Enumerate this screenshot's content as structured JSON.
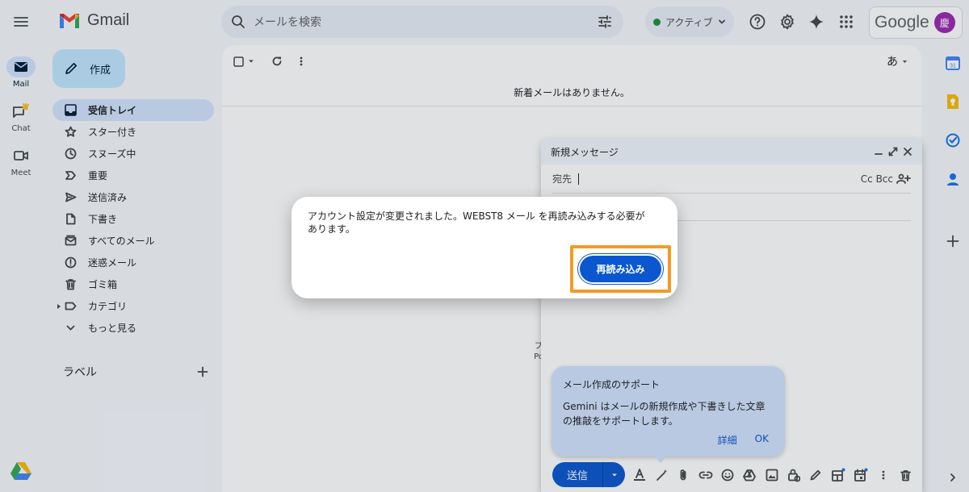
{
  "topbar": {
    "app_name": "Gmail",
    "search_placeholder": "メールを検索",
    "status_label": "アクティブ",
    "google_word": "Google",
    "avatar_initial": "慶"
  },
  "rail": {
    "items": [
      {
        "label": "Mail",
        "icon": "mail-icon",
        "active": true
      },
      {
        "label": "Chat",
        "icon": "chat-icon",
        "active": false
      },
      {
        "label": "Meet",
        "icon": "meet-icon",
        "active": false
      }
    ]
  },
  "compose_button": {
    "label": "作成"
  },
  "nav": {
    "items": [
      {
        "label": "受信トレイ",
        "icon": "inbox-icon",
        "active": true
      },
      {
        "label": "スター付き",
        "icon": "star-icon"
      },
      {
        "label": "スヌーズ中",
        "icon": "clock-icon"
      },
      {
        "label": "重要",
        "icon": "important-icon"
      },
      {
        "label": "送信済み",
        "icon": "send-icon"
      },
      {
        "label": "下書き",
        "icon": "draft-icon"
      },
      {
        "label": "すべてのメール",
        "icon": "all-mail-icon"
      },
      {
        "label": "迷惑メール",
        "icon": "spam-icon"
      },
      {
        "label": "ゴミ箱",
        "icon": "trash-icon"
      },
      {
        "label": "カテゴリ",
        "icon": "label-icon"
      },
      {
        "label": "もっと見る",
        "icon": "chevron-down-icon"
      }
    ],
    "labels_header": "ラベル"
  },
  "main": {
    "lang_label": "あ",
    "empty_message": "新着メールはありません。"
  },
  "compose_window": {
    "title": "新規メッセージ",
    "to_label": "宛先",
    "cc_bcc": "Cc Bcc",
    "peek_text_1": "プ",
    "peek_text_2": "Po"
  },
  "gemini": {
    "title": "メール作成のサポート",
    "body": "Gemini はメールの新規作成や下書きした文章の推敲をサポートします。",
    "details": "詳細",
    "ok": "OK"
  },
  "compose_toolbar": {
    "send_label": "送信"
  },
  "modal": {
    "message": "アカウント設定が変更されました。WEBST8 メール を再読み込みする必要があります。",
    "reload_label": "再読み込み"
  },
  "colors": {
    "accent": "#0b57d0",
    "highlight_frame": "#f59a23",
    "avatar": "#9c27b0"
  }
}
